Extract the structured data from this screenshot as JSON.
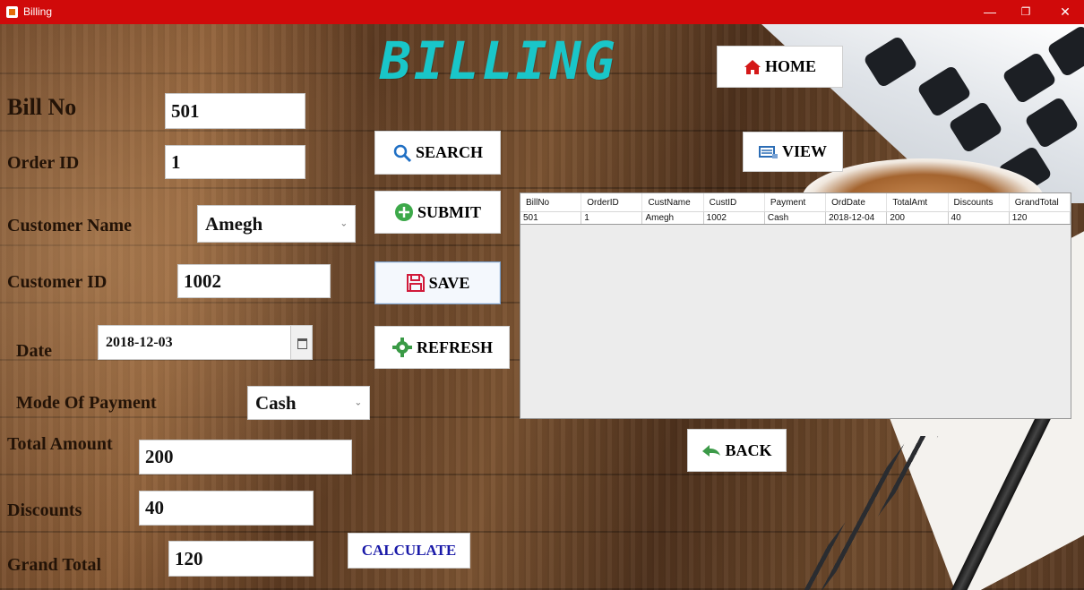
{
  "window": {
    "title": "Billing",
    "minimize": "—",
    "maximize": "❐",
    "close": "✕"
  },
  "heading": "BILLING",
  "colors": {
    "titlebar": "#d00a0a",
    "heading": "#19c6c9",
    "calculate_text": "#1a1aa8"
  },
  "form": {
    "bill_no": {
      "label": "Bill No",
      "value": "501"
    },
    "order_id": {
      "label": "Order ID",
      "value": "1"
    },
    "customer_name": {
      "label": "Customer Name",
      "value": "Amegh"
    },
    "customer_id": {
      "label": "Customer ID",
      "value": "1002"
    },
    "date": {
      "label": "Date",
      "value": "2018-12-03"
    },
    "mode_of_payment": {
      "label": "Mode Of Payment",
      "value": "Cash"
    },
    "total_amount": {
      "label": "Total Amount",
      "value": "200"
    },
    "discounts": {
      "label": "Discounts",
      "value": "40"
    },
    "grand_total": {
      "label": "Grand Total",
      "value": "120"
    }
  },
  "buttons": {
    "home": {
      "label": "HOME",
      "icon": "home-icon"
    },
    "search": {
      "label": "SEARCH",
      "icon": "search-icon"
    },
    "view": {
      "label": "VIEW",
      "icon": "view-icon"
    },
    "submit": {
      "label": "SUBMIT",
      "icon": "plus-circle-icon"
    },
    "save": {
      "label": "SAVE",
      "icon": "save-icon"
    },
    "refresh": {
      "label": "REFRESH",
      "icon": "gear-refresh-icon"
    },
    "back": {
      "label": "BACK",
      "icon": "back-arrow-icon"
    },
    "calculate": {
      "label": "CALCULATE"
    }
  },
  "table": {
    "columns": [
      "BillNo",
      "OrderID",
      "CustName",
      "CustID",
      "Payment",
      "OrdDate",
      "TotalAmt",
      "Discounts",
      "GrandTotal"
    ],
    "rows": [
      [
        "501",
        "1",
        "Amegh",
        "1002",
        "Cash",
        "2018-12-04",
        "200",
        "40",
        "120"
      ]
    ]
  }
}
